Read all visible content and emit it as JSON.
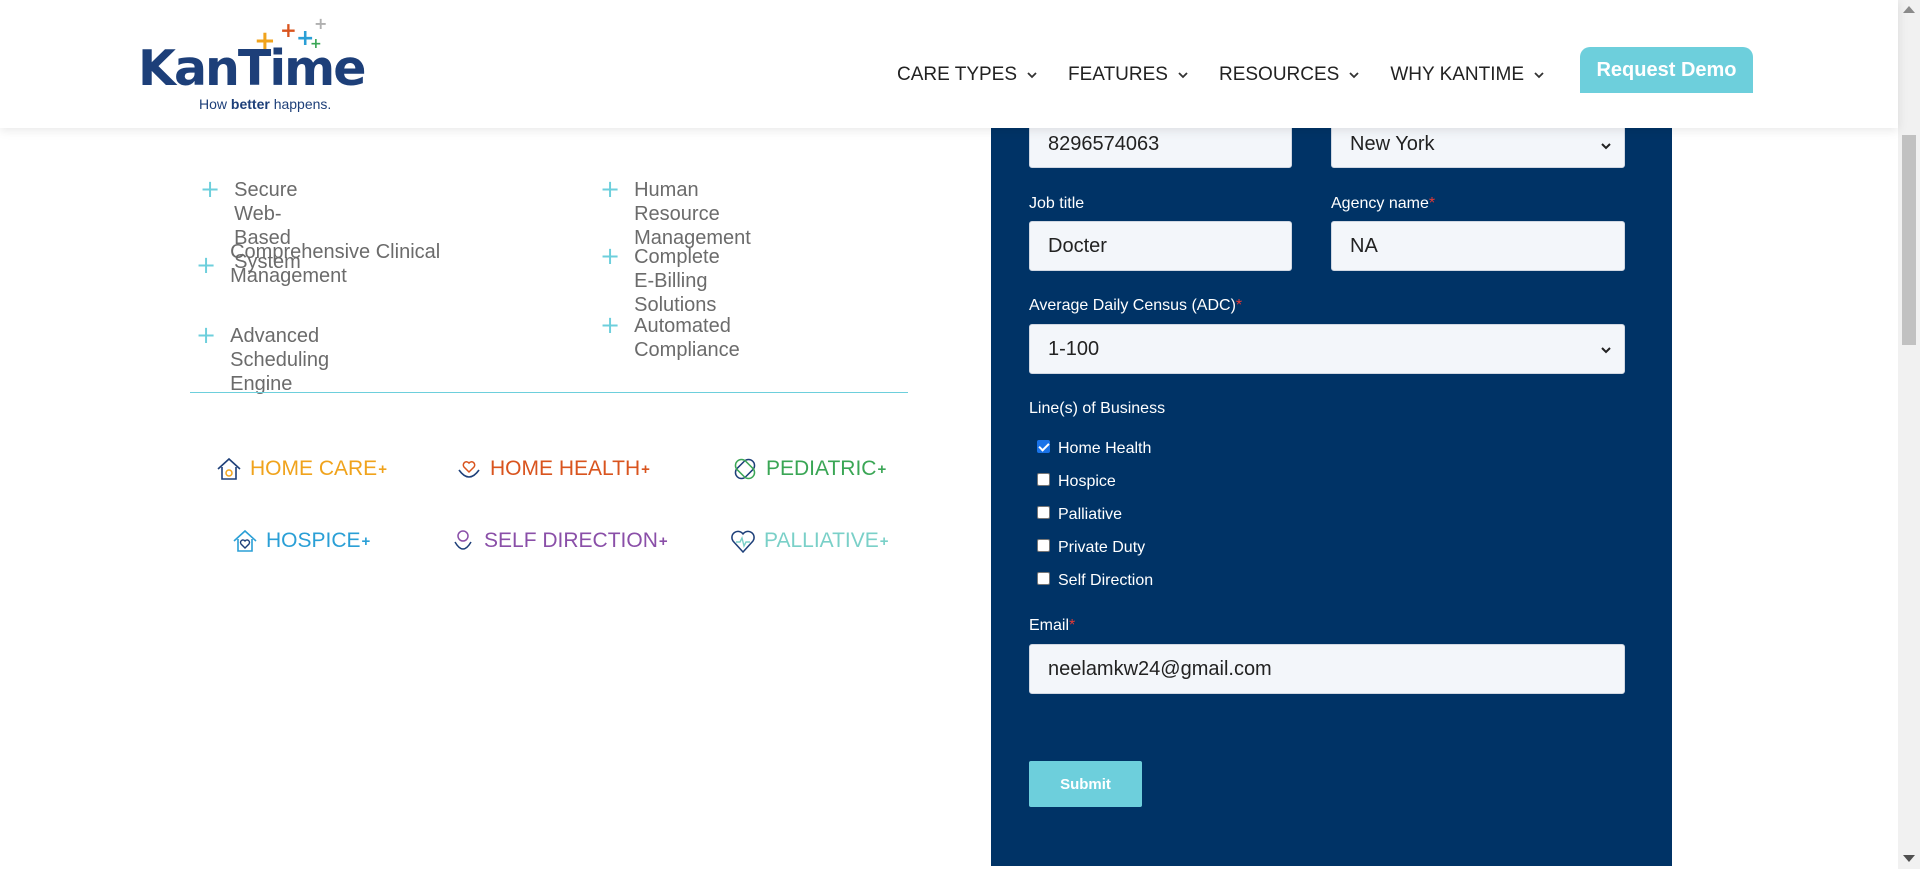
{
  "header": {
    "logo_text": "KanTime",
    "logo_tagline_pre": "How",
    "logo_tagline_bold": "better",
    "logo_tagline_post": "happens.",
    "nav": [
      {
        "label": "CARE TYPES"
      },
      {
        "label": "FEATURES"
      },
      {
        "label": "RESOURCES"
      },
      {
        "label": "WHY KANTIME"
      }
    ],
    "cta_label": "Request Demo"
  },
  "features": {
    "left": [
      "Secure Web-Based System",
      "Comprehensive Clinical Management",
      "Advanced Scheduling Engine"
    ],
    "right": [
      "Human Resource Management",
      "Complete E-Billing Solutions",
      "Automated Compliance"
    ]
  },
  "care_types": [
    {
      "label": "HOME CARE",
      "color": "#f0a31c",
      "icon": "house-icon"
    },
    {
      "label": "HOME HEALTH",
      "color": "#d9541e",
      "icon": "hands-heart-icon"
    },
    {
      "label": "PEDIATRIC",
      "color": "#3aa655",
      "icon": "pediatric-icon"
    },
    {
      "label": "HOSPICE",
      "color": "#2a9fd6",
      "icon": "hospice-house-icon"
    },
    {
      "label": "SELF DIRECTION",
      "color": "#8a4fa8",
      "icon": "flower-hands-icon"
    },
    {
      "label": "PALLIATIVE",
      "color": "#7ad0c8",
      "icon": "heart-pulse-icon"
    }
  ],
  "form": {
    "phone_value": "8296574063",
    "state_value": "New York",
    "job_title_label": "Job title",
    "job_title_value": "Docter",
    "agency_label": "Agency name",
    "agency_value": "NA",
    "adc_label": "Average Daily Census (ADC)",
    "adc_value": "1-100",
    "lob_label": "Line(s) of Business",
    "lob_options": [
      {
        "label": "Home Health",
        "checked": true
      },
      {
        "label": "Hospice",
        "checked": false
      },
      {
        "label": "Palliative",
        "checked": false
      },
      {
        "label": "Private Duty",
        "checked": false
      },
      {
        "label": "Self Direction",
        "checked": false
      }
    ],
    "email_label": "Email",
    "email_value": "neelamkw24@gmail.com",
    "required_mark": "*",
    "submit_label": "Submit"
  },
  "colors": {
    "brand_navy": "#1d3f79",
    "accent_teal": "#6dcfdc",
    "form_bg": "#003366"
  }
}
